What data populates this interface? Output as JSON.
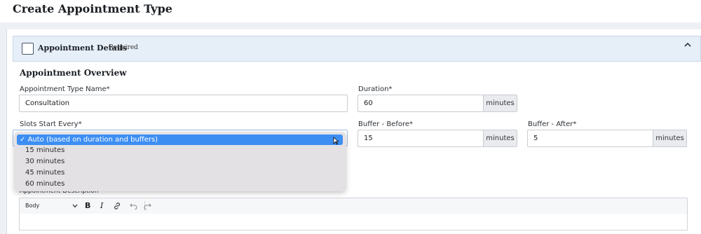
{
  "page": {
    "title": "Create Appointment Type"
  },
  "section": {
    "title": "Appointment Details",
    "required_label": "Required",
    "subheading": "Appointment Overview"
  },
  "fields": {
    "name": {
      "label": "Appointment Type Name*",
      "value": "Consultation"
    },
    "duration": {
      "label": "Duration*",
      "value": "60",
      "unit": "minutes"
    },
    "slots": {
      "label": "Slots Start Every*",
      "options": [
        "Auto (based on duration and buffers)",
        "15 minutes",
        "30 minutes",
        "45 minutes",
        "60 minutes"
      ],
      "selected_marker": "✓"
    },
    "buffer_before": {
      "label": "Buffer - Before*",
      "value": "15",
      "unit": "minutes"
    },
    "buffer_after": {
      "label": "Buffer - After*",
      "value": "5",
      "unit": "minutes"
    }
  },
  "description": {
    "label": "Appointment Description",
    "toolbar": {
      "style_value": "Body",
      "bold": "B",
      "italic": "I"
    }
  },
  "icons": {
    "collapse": "chevron-up-icon",
    "checkbox": "checkbox-icon",
    "link": "link-icon",
    "undo": "undo-icon",
    "redo": "redo-icon"
  },
  "colors": {
    "accent": "#3c8ef3",
    "section_header_bg": "#e6eef8"
  }
}
